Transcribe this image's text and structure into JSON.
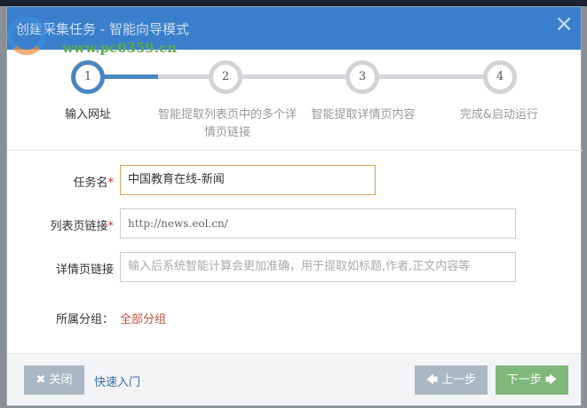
{
  "dialog": {
    "title": "创建采集任务 - 智能向导模式",
    "close_icon": "×",
    "watermark": "www.pc0359.cn"
  },
  "steps": [
    {
      "num": "1",
      "label": "输入网址",
      "active": true
    },
    {
      "num": "2",
      "label": "智能提取列表页中的多个详情页链接",
      "active": false
    },
    {
      "num": "3",
      "label": "智能提取详情页内容",
      "active": false
    },
    {
      "num": "4",
      "label": "完成&启动运行",
      "active": false
    }
  ],
  "form": {
    "task_name": {
      "label": "任务名",
      "required": "*",
      "value": "中国教育在线-新闻"
    },
    "list_url": {
      "label": "列表页链接",
      "required": "*",
      "value": "http://news.eol.cn/"
    },
    "detail_url": {
      "label": "详情页链接",
      "placeholder": "输入后系统智能计算会更加准确，用于提取如标题,作者,正文内容等"
    },
    "group": {
      "label": "所属分组：",
      "value": "全部分组"
    }
  },
  "footer": {
    "close": "✖ 关闭",
    "quick": "快速入门",
    "prev": "🡄 上一步",
    "next": "下一步 🡆"
  },
  "colors": {
    "header": "#3a7fcb",
    "active": "#4a86bf",
    "prev": "#a9b8c4",
    "next": "#7fb87a",
    "close": "#a9b8c4"
  }
}
